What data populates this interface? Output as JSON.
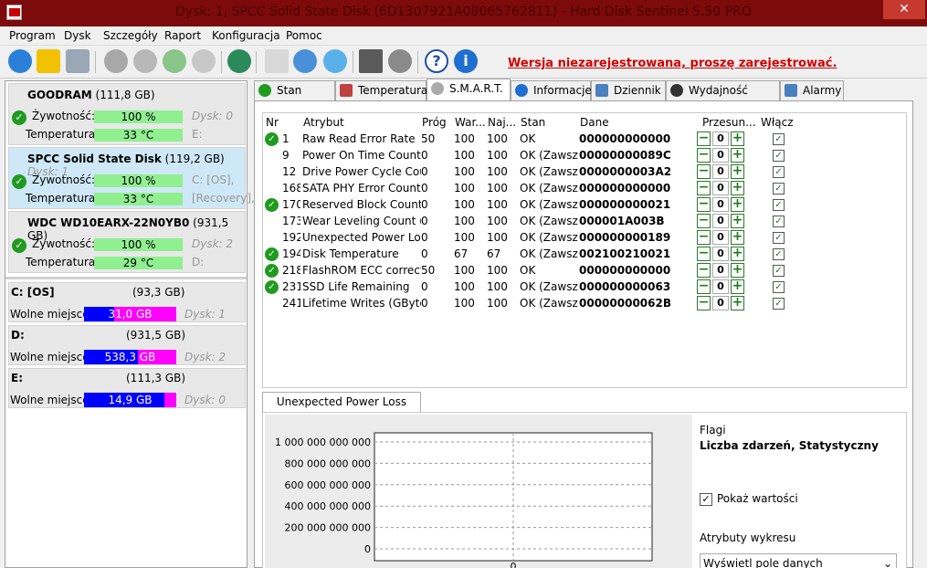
{
  "window": {
    "title": "Dysk: 1, SPCC Solid State Disk (6D1307921A08065762811) - Hard Disk Sentinel 5.50 PRO",
    "close": "✕"
  },
  "menu": [
    "Program",
    "Dysk",
    "Szczegóły",
    "Raport",
    "Konfiguracja",
    "Pomoc"
  ],
  "registration": "Wersja niezarejestrowana, proszę zarejestrować.",
  "disks": [
    {
      "name": "GOODRAM",
      "size": "(111,8 GB)",
      "sub": "",
      "health_label": "Żywotność:",
      "health": "100 %",
      "health_pct": 100,
      "extra1": "Dysk: 0",
      "temp_label": "Temperatura:",
      "temp": "33 °C",
      "extra2": "E:"
    },
    {
      "name": "SPCC Solid State Disk",
      "size": "(119,2 GB)",
      "sub": "Dysk: 1",
      "health_label": "Żywotność:",
      "health": "100 %",
      "health_pct": 100,
      "extra1": "C: [OS],",
      "temp_label": "Temperatura:",
      "temp": "33 °C",
      "extra2": "[Recovery],"
    },
    {
      "name": "WDC WD10EARX-22N0YB0",
      "size": "(931,5 GB)",
      "sub": "",
      "health_label": "Żywotność:",
      "health": "100 %",
      "health_pct": 100,
      "extra1": "Dysk: 2",
      "temp_label": "Temperatura:",
      "temp": "29 °C",
      "extra2": "D:"
    }
  ],
  "volumes": [
    {
      "name": "C: [OS]",
      "size": "(93,3 GB)",
      "free_label": "Wolne miejsce",
      "free": "31,0 GB",
      "used_fraction": 0.67,
      "disk": "Dysk: 1"
    },
    {
      "name": "D:",
      "size": "(931,5 GB)",
      "free_label": "Wolne miejsce",
      "free": "538,3 GB",
      "used_fraction": 0.42,
      "disk": "Dysk: 2"
    },
    {
      "name": "E:",
      "size": "(111,3 GB)",
      "free_label": "Wolne miejsce",
      "free": "14,9 GB",
      "used_fraction": 0.13,
      "disk": "Dysk: 0"
    }
  ],
  "tabs": [
    "Stan dysku",
    "Temperatura",
    "S.M.A.R.T.",
    "Informacje",
    "Dziennik",
    "Wydajność dysku",
    "Alarmy"
  ],
  "smart": {
    "headers": {
      "nr": "Nr",
      "attr": "Atrybut",
      "thr": "Próg",
      "val": "War...",
      "worst": "Naj...",
      "status": "Stan",
      "data": "Dane",
      "offset": "Przesun...",
      "enable": "Włącz"
    },
    "rows": [
      {
        "ok": true,
        "nr": "1",
        "attr": "Raw Read Error Rate",
        "thr": "50",
        "val": "100",
        "worst": "100",
        "status": "OK",
        "data": "000000000000",
        "offset": "0"
      },
      {
        "ok": false,
        "nr": "9",
        "attr": "Power On Time Count",
        "thr": "0",
        "val": "100",
        "worst": "100",
        "status": "OK (Zawsz...",
        "data": "00000000089C",
        "offset": "0"
      },
      {
        "ok": false,
        "nr": "12",
        "attr": "Drive Power Cycle Count",
        "thr": "0",
        "val": "100",
        "worst": "100",
        "status": "OK (Zawsz...",
        "data": "0000000003A2",
        "offset": "0"
      },
      {
        "ok": false,
        "nr": "168",
        "attr": "SATA PHY Error Count",
        "thr": "0",
        "val": "100",
        "worst": "100",
        "status": "OK (Zawsz...",
        "data": "000000000000",
        "offset": "0"
      },
      {
        "ok": true,
        "nr": "170",
        "attr": "Reserved Block Count",
        "thr": "0",
        "val": "100",
        "worst": "100",
        "status": "OK (Zawsz...",
        "data": "000000000021",
        "offset": "0"
      },
      {
        "ok": false,
        "nr": "173",
        "attr": "Wear Leveling Count (t...",
        "thr": "0",
        "val": "100",
        "worst": "100",
        "status": "OK (Zawsz...",
        "data": "000001A003B",
        "offset": "0"
      },
      {
        "ok": false,
        "nr": "192",
        "attr": "Unexpected Power Loss...",
        "thr": "0",
        "val": "100",
        "worst": "100",
        "status": "OK (Zawsz...",
        "data": "000000000189",
        "offset": "0"
      },
      {
        "ok": true,
        "nr": "194",
        "attr": "Disk Temperature",
        "thr": "0",
        "val": "67",
        "worst": "67",
        "status": "OK (Zawsz...",
        "data": "002100210021",
        "offset": "0"
      },
      {
        "ok": true,
        "nr": "218",
        "attr": "FlashROM ECC correcti...",
        "thr": "50",
        "val": "100",
        "worst": "100",
        "status": "OK",
        "data": "000000000000",
        "offset": "0"
      },
      {
        "ok": true,
        "nr": "231",
        "attr": "SSD Life Remaining",
        "thr": "0",
        "val": "100",
        "worst": "100",
        "status": "OK (Zawsz...",
        "data": "000000000063",
        "offset": "0"
      },
      {
        "ok": false,
        "nr": "241",
        "attr": "Lifetime Writes (GBytes)",
        "thr": "0",
        "val": "100",
        "worst": "100",
        "status": "OK (Zawsz...",
        "data": "00000000062B",
        "offset": "0"
      }
    ]
  },
  "chart_tab": "Unexpected Power Loss Count",
  "chart_data": {
    "type": "line",
    "yticks": [
      "1 000 000 000 000",
      "800 000 000 000",
      "600 000 000 000",
      "400 000 000 000",
      "200 000 000 000",
      "0"
    ],
    "ylim": [
      0,
      1000000000000
    ],
    "xticks": [
      "0"
    ]
  },
  "flags": {
    "label": "Flagi",
    "value": "Liczba zdarzeń, Statystyczny",
    "show_values": "Pokaż wartości",
    "chart_attr_label": "Atrybuty wykresu",
    "chart_attr_value": "Wyświetl pole danych"
  },
  "colors": {
    "titlebar": "#7d0b0b",
    "health_bar": "#90f090",
    "free_bar": "#0000ff",
    "used_bar": "#ff00ff",
    "ok_icon": "#1f9b1f",
    "registration": "#d20000"
  }
}
